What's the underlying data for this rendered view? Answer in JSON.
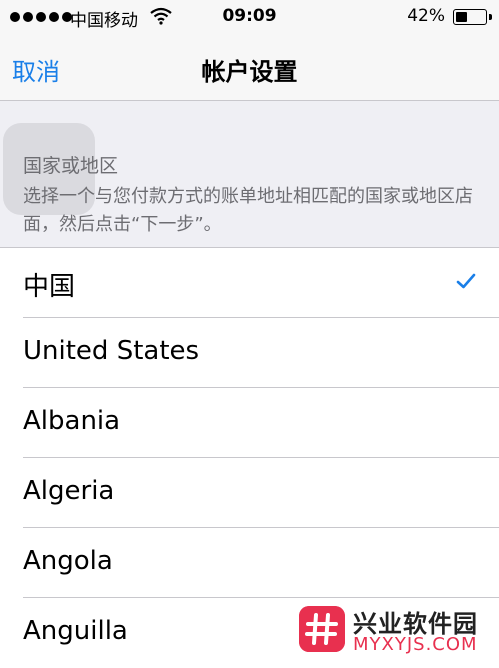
{
  "status_bar": {
    "carrier": "中国移动",
    "time": "09:09",
    "battery_percent": "42%",
    "battery_level": 0.42
  },
  "nav": {
    "cancel_label": "取消",
    "title": "帐户设置"
  },
  "section": {
    "header": "国家或地区",
    "description": "选择一个与您付款方式的账单地址相匹配的国家或地区店面，然后点击“下一步”。"
  },
  "countries": [
    {
      "name": "中国",
      "selected": true
    },
    {
      "name": "United States",
      "selected": false
    },
    {
      "name": "Albania",
      "selected": false
    },
    {
      "name": "Algeria",
      "selected": false
    },
    {
      "name": "Angola",
      "selected": false
    },
    {
      "name": "Anguilla",
      "selected": false
    }
  ],
  "watermark": {
    "name": "兴业软件园",
    "url": "MYXYJS.COM"
  },
  "colors": {
    "accent": "#1a7fe8",
    "section_bg": "#efeff4",
    "separator": "#c8c7cc",
    "watermark_red": "#e8304f"
  }
}
